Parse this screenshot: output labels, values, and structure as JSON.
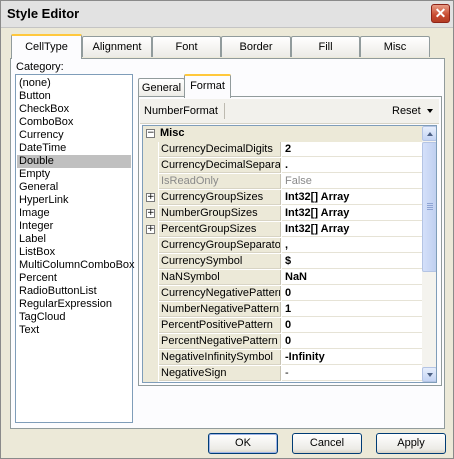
{
  "window": {
    "title": "Style Editor",
    "close_glyph": "✕"
  },
  "outer_tabs": [
    "CellType",
    "Alignment",
    "Font",
    "Border",
    "Fill",
    "Misc"
  ],
  "category": {
    "label": "Category:",
    "items": [
      "(none)",
      "Button",
      "CheckBox",
      "ComboBox",
      "Currency",
      "DateTime",
      "Double",
      "Empty",
      "General",
      "HyperLink",
      "Image",
      "Integer",
      "Label",
      "ListBox",
      "MultiColumnComboBox",
      "Percent",
      "RadioButtonList",
      "RegularExpression",
      "TagCloud",
      "Text"
    ],
    "selected": "Double"
  },
  "inner_tabs": [
    "General",
    "Format"
  ],
  "toolbar": {
    "number_format_label": "NumberFormat",
    "reset_label": "Reset"
  },
  "grid": {
    "category_title": "Misc",
    "category_expander": "−",
    "rows": [
      {
        "name": "CurrencyDecimalDigits",
        "value": "2",
        "expander": "",
        "bold": true,
        "gray": false
      },
      {
        "name": "CurrencyDecimalSeparator",
        "value": ".",
        "expander": "",
        "bold": true,
        "gray": false
      },
      {
        "name": "IsReadOnly",
        "value": "False",
        "expander": "",
        "bold": false,
        "gray": true
      },
      {
        "name": "CurrencyGroupSizes",
        "value": "Int32[] Array",
        "expander": "+",
        "bold": true,
        "gray": false
      },
      {
        "name": "NumberGroupSizes",
        "value": "Int32[] Array",
        "expander": "+",
        "bold": true,
        "gray": false
      },
      {
        "name": "PercentGroupSizes",
        "value": "Int32[] Array",
        "expander": "+",
        "bold": true,
        "gray": false
      },
      {
        "name": "CurrencyGroupSeparator",
        "value": ",",
        "expander": "",
        "bold": true,
        "gray": false
      },
      {
        "name": "CurrencySymbol",
        "value": "$",
        "expander": "",
        "bold": true,
        "gray": false
      },
      {
        "name": "NaNSymbol",
        "value": "NaN",
        "expander": "",
        "bold": true,
        "gray": false
      },
      {
        "name": "CurrencyNegativePattern",
        "value": "0",
        "expander": "",
        "bold": true,
        "gray": false
      },
      {
        "name": "NumberNegativePattern",
        "value": "1",
        "expander": "",
        "bold": true,
        "gray": false
      },
      {
        "name": "PercentPositivePattern",
        "value": "0",
        "expander": "",
        "bold": true,
        "gray": false
      },
      {
        "name": "PercentNegativePattern",
        "value": "0",
        "expander": "",
        "bold": true,
        "gray": false
      },
      {
        "name": "NegativeInfinitySymbol",
        "value": "-Infinity",
        "expander": "",
        "bold": true,
        "gray": false
      },
      {
        "name": "NegativeSign",
        "value": "-",
        "expander": "",
        "bold": false,
        "gray": false
      }
    ]
  },
  "buttons": {
    "ok": "OK",
    "cancel": "Cancel",
    "apply": "Apply"
  }
}
